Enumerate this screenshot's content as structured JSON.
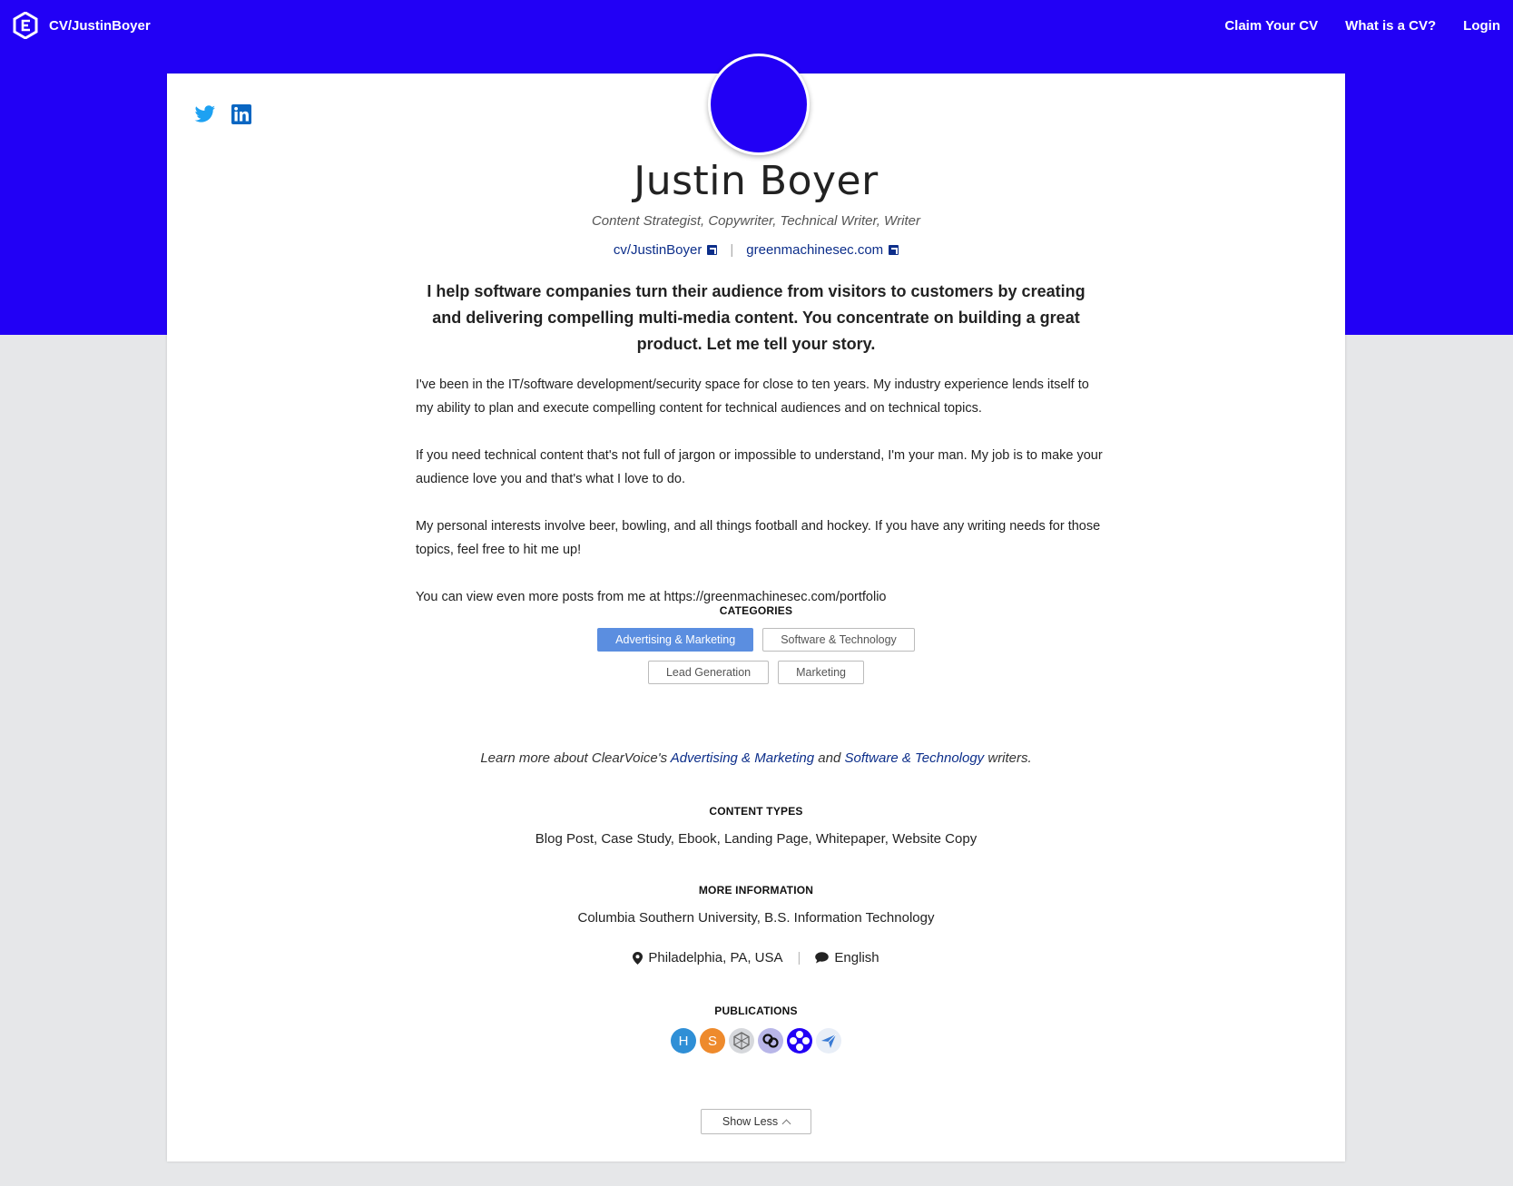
{
  "nav": {
    "brand": "CV/JustinBoyer",
    "links": [
      "Claim Your CV",
      "What is a CV?",
      "Login"
    ]
  },
  "profile": {
    "name": "Justin Boyer",
    "roles": "Content Strategist, Copywriter, Technical Writer, Writer",
    "cv_link": "cv/JustinBoyer",
    "site_link": "greenmachinesec.com",
    "tagline": "I help software companies turn their audience from visitors to customers by creating and delivering compelling multi-media content. You concentrate on building a great product. Let me tell your story.",
    "bio": [
      "I've been in the IT/software development/security space for close to ten years. My industry experience lends itself to my ability to plan and execute compelling content for technical audiences and on technical topics.",
      "If you need technical content that's not full of jargon or impossible to understand, I'm your man. My job is to make your audience love you and that's what I love to do.",
      "My personal interests involve beer, bowling, and all things football and hockey. If you have any writing needs for those topics, feel free to hit me up!",
      "You can view even more posts from me at https://greenmachinesec.com/portfolio"
    ]
  },
  "categories": {
    "title": "CATEGORIES",
    "items": [
      "Advertising & Marketing",
      "Software & Technology",
      "Lead Generation",
      "Marketing"
    ]
  },
  "learn": {
    "prefix": "Learn more about ClearVoice's ",
    "link1": "Advertising & Marketing",
    "middle": " and ",
    "link2": "Software & Technology",
    "suffix": " writers."
  },
  "content_types": {
    "title": "CONTENT TYPES",
    "value": "Blog Post, Case Study, Ebook, Landing Page, Whitepaper, Website Copy"
  },
  "more_info": {
    "title": "MORE INFORMATION",
    "education": "Columbia Southern University, B.S. Information Technology",
    "location": "Philadelphia, PA, USA",
    "language": "English"
  },
  "publications": {
    "title": "PUBLICATIONS",
    "items": [
      {
        "letter": "H",
        "color": "#2f8fd6"
      },
      {
        "letter": "S",
        "color": "#ee8a2c"
      },
      {
        "letter": "",
        "color": "#d6d8dc"
      },
      {
        "letter": "",
        "color": "#b8b6e8"
      },
      {
        "letter": "",
        "color": "#2200f5"
      },
      {
        "letter": "",
        "color": "#e8eef7"
      }
    ]
  },
  "show_less": "Show Less",
  "colors": {
    "brand": "#2200f5",
    "link": "#0c2e8a",
    "active_pill": "#5b8ee0",
    "background": "#e6e7e9"
  }
}
